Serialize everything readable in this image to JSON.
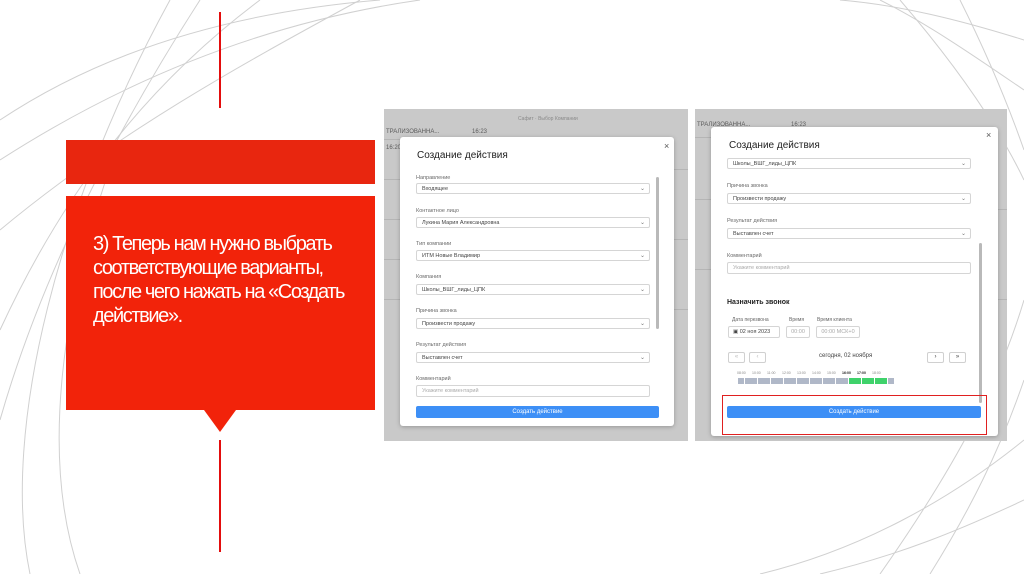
{
  "slide": {
    "text": "3) Теперь нам нужно выбрать соответствующие варианты, после чего нажать на «Создать действие»."
  },
  "colors": {
    "accent_red": "#f2230a",
    "button_blue": "#3d8ff6",
    "slot_gray": "#b0b8c8",
    "slot_green": "#3fd26b"
  },
  "left_shot": {
    "background_texts": [
      "ТРАЛИЗОВАННА...",
      "16:23",
      "Сафит · Выбор Компании",
      "16:20"
    ],
    "modal": {
      "title": "Создание действия",
      "close": "×",
      "fields": [
        {
          "label": "Направление",
          "value": "Входящее"
        },
        {
          "label": "Контактное лицо",
          "value": "Лукина Мария Александровна"
        },
        {
          "label": "Тип компании",
          "value": "ИТМ Новые Владимир"
        },
        {
          "label": "Компания",
          "value": "Школы_ВШГ_лиды_ЦПК"
        },
        {
          "label": "Причина звонка",
          "value": "Произвести продажу"
        },
        {
          "label": "Результат действия",
          "value": "Выставлен счет"
        }
      ],
      "comment": {
        "label": "Комментарий",
        "placeholder": "Укажите комментарий"
      },
      "submit": "Создать действие"
    }
  },
  "right_shot": {
    "background_texts": [
      "ТРАЛИЗОВАННА...",
      "16:23"
    ],
    "modal": {
      "title": "Создание действия",
      "close": "×",
      "fields": [
        {
          "label": "",
          "value": "Школы_ВШГ_лиды_ЦПК"
        },
        {
          "label": "Причина звонка",
          "value": "Произвести продажу"
        },
        {
          "label": "Результат действия",
          "value": "Выставлен счет"
        }
      ],
      "comment": {
        "label": "Комментарий",
        "placeholder": "Укажите комментарий"
      },
      "schedule": {
        "title": "Назначить звонок",
        "date_label": "Дата перезвона",
        "date_value": "02 ноя 2023",
        "time_label": "Время",
        "time_value": "00:00",
        "client_time_label": "Время клиента",
        "client_time_value": "00:00 МСК+0",
        "day_label": "сегодня, 02 ноября",
        "prev_first": "«",
        "prev": "‹",
        "next": "›",
        "next_last": "»",
        "time_labels": [
          "08:00",
          "10:00",
          "11:00",
          "12:00",
          "13:00",
          "14:00",
          "15:00",
          "16:00",
          "17:00",
          "18:00"
        ]
      },
      "submit": "Создать действие"
    }
  }
}
